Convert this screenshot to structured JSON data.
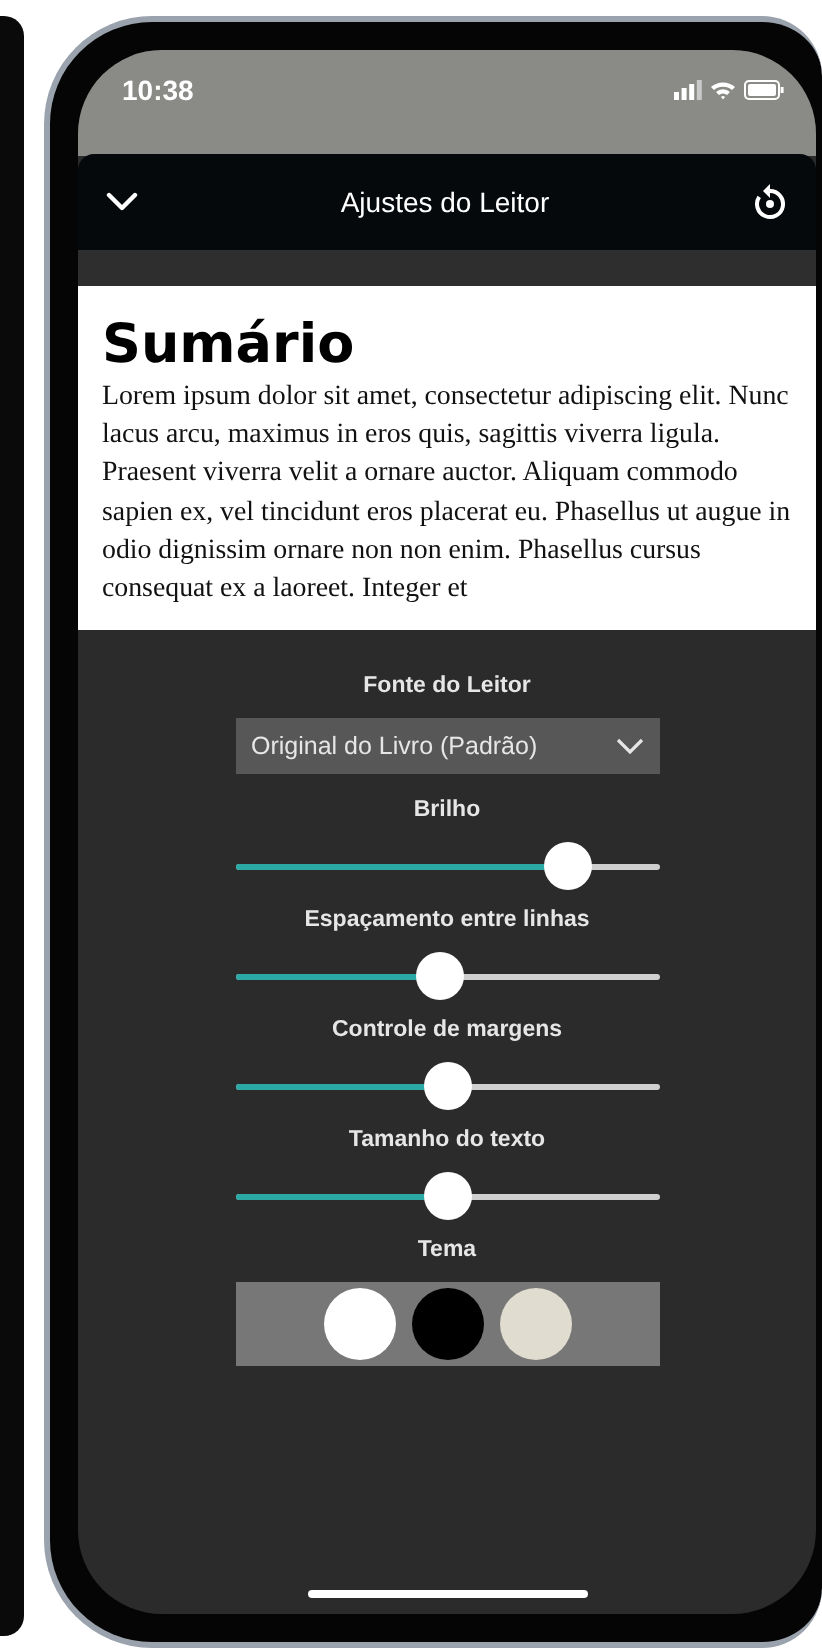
{
  "status_bar": {
    "time": "10:38"
  },
  "header": {
    "title": "Ajustes do Leitor"
  },
  "preview": {
    "heading": "Sumário",
    "body": "Lorem ipsum dolor sit amet, consectetur adipiscing elit. Nunc lacus arcu, maximus in eros quis, sagittis viverra ligula. Praesent viverra velit a ornare auctor. Aliquam commodo sapien ex, vel tincidunt eros placerat eu. Phasellus ut augue in odio dignissim ornare non non enim. Phasellus cursus consequat ex a laoreet. Integer et"
  },
  "settings": {
    "font": {
      "label": "Fonte do Leitor",
      "value": "Original do Livro (Padrão)"
    },
    "sliders": [
      {
        "label": "Brilho",
        "level": 0.82
      },
      {
        "label": "Espaçamento entre linhas",
        "level": 0.48
      },
      {
        "label": "Controle de margens",
        "level": 0.5
      },
      {
        "label": "Tamanho do texto",
        "level": 0.5
      }
    ],
    "theme": {
      "label": "Tema",
      "options": [
        {
          "color": "#ffffff"
        },
        {
          "color": "#000000"
        },
        {
          "color": "#e0ddd0"
        }
      ]
    }
  }
}
